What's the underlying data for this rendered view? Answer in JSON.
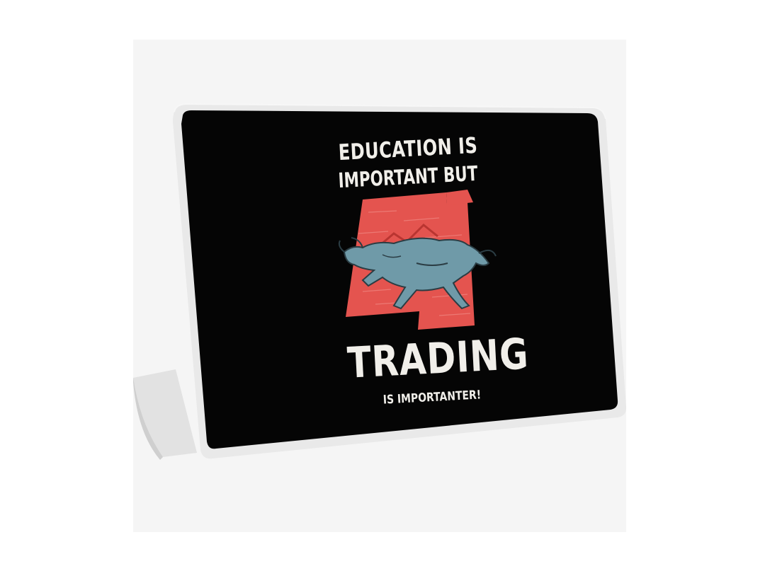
{
  "artwork": {
    "line_1": "EDUCATION IS",
    "line_2": "IMPORTANT BUT",
    "line_3": "TRADING",
    "line_4": "IS IMPORTANTER!"
  },
  "colors": {
    "skin_background": "#050505",
    "chart_panel": "#e4544f",
    "bull": "#6f9aa8",
    "text": "#f1efea",
    "laptop_body": "#e9e9e9"
  },
  "icons": [
    "bull-illustration"
  ]
}
